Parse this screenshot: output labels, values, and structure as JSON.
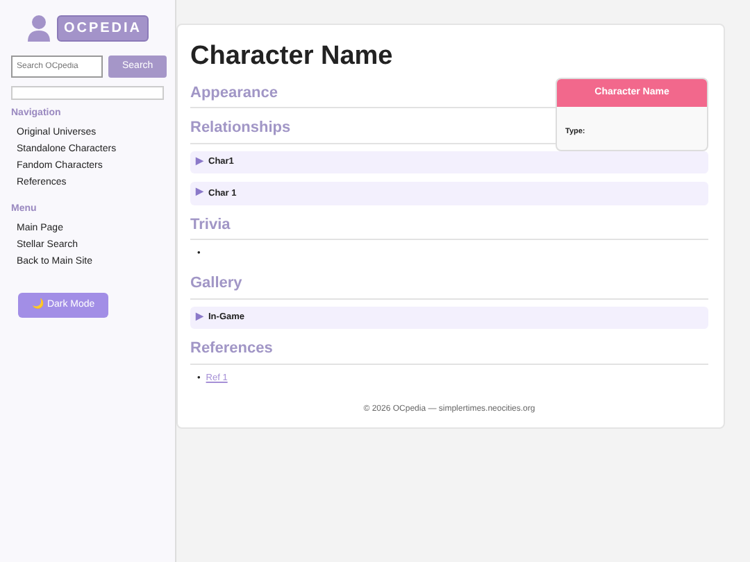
{
  "sidebar": {
    "logo_text": "OCPEDIA",
    "search": {
      "placeholder": "Search OCpedia",
      "button": "Search"
    },
    "sections": [
      {
        "title": "Navigation",
        "items": [
          "Original Universes",
          "Standalone Characters",
          "Fandom Characters",
          "References"
        ]
      },
      {
        "title": "Menu",
        "items": [
          "Main Page",
          "Stellar Search",
          "Back to Main Site"
        ]
      }
    ],
    "theme_button": {
      "icon": "🌙",
      "label": "Dark Mode"
    }
  },
  "page": {
    "title": "Character Name",
    "infobox": {
      "title": "Character Name",
      "fields": [
        {
          "label": "Type:"
        }
      ]
    },
    "sections": [
      {
        "heading": "Appearance",
        "kind": "empty"
      },
      {
        "heading": "Relationships",
        "kind": "collapsibles",
        "items": [
          {
            "marker": "▶",
            "label": "Char1",
            "expanded": false
          },
          {
            "marker": "▶",
            "label": "Char 1",
            "expanded": false
          }
        ]
      },
      {
        "heading": "Trivia",
        "kind": "bullets",
        "items": [
          {
            "kind": "empty",
            "marker": "•"
          }
        ]
      },
      {
        "heading": "Gallery",
        "kind": "collapsibles",
        "items": [
          {
            "marker": "▶",
            "label": "In-Game",
            "expanded": false
          }
        ]
      },
      {
        "heading": "References",
        "kind": "bullets",
        "items": [
          {
            "kind": "link",
            "marker": "•",
            "text": "Ref 1"
          }
        ]
      }
    ],
    "footer": "© 2026 OCpedia — simplertimes.neocities.org"
  }
}
